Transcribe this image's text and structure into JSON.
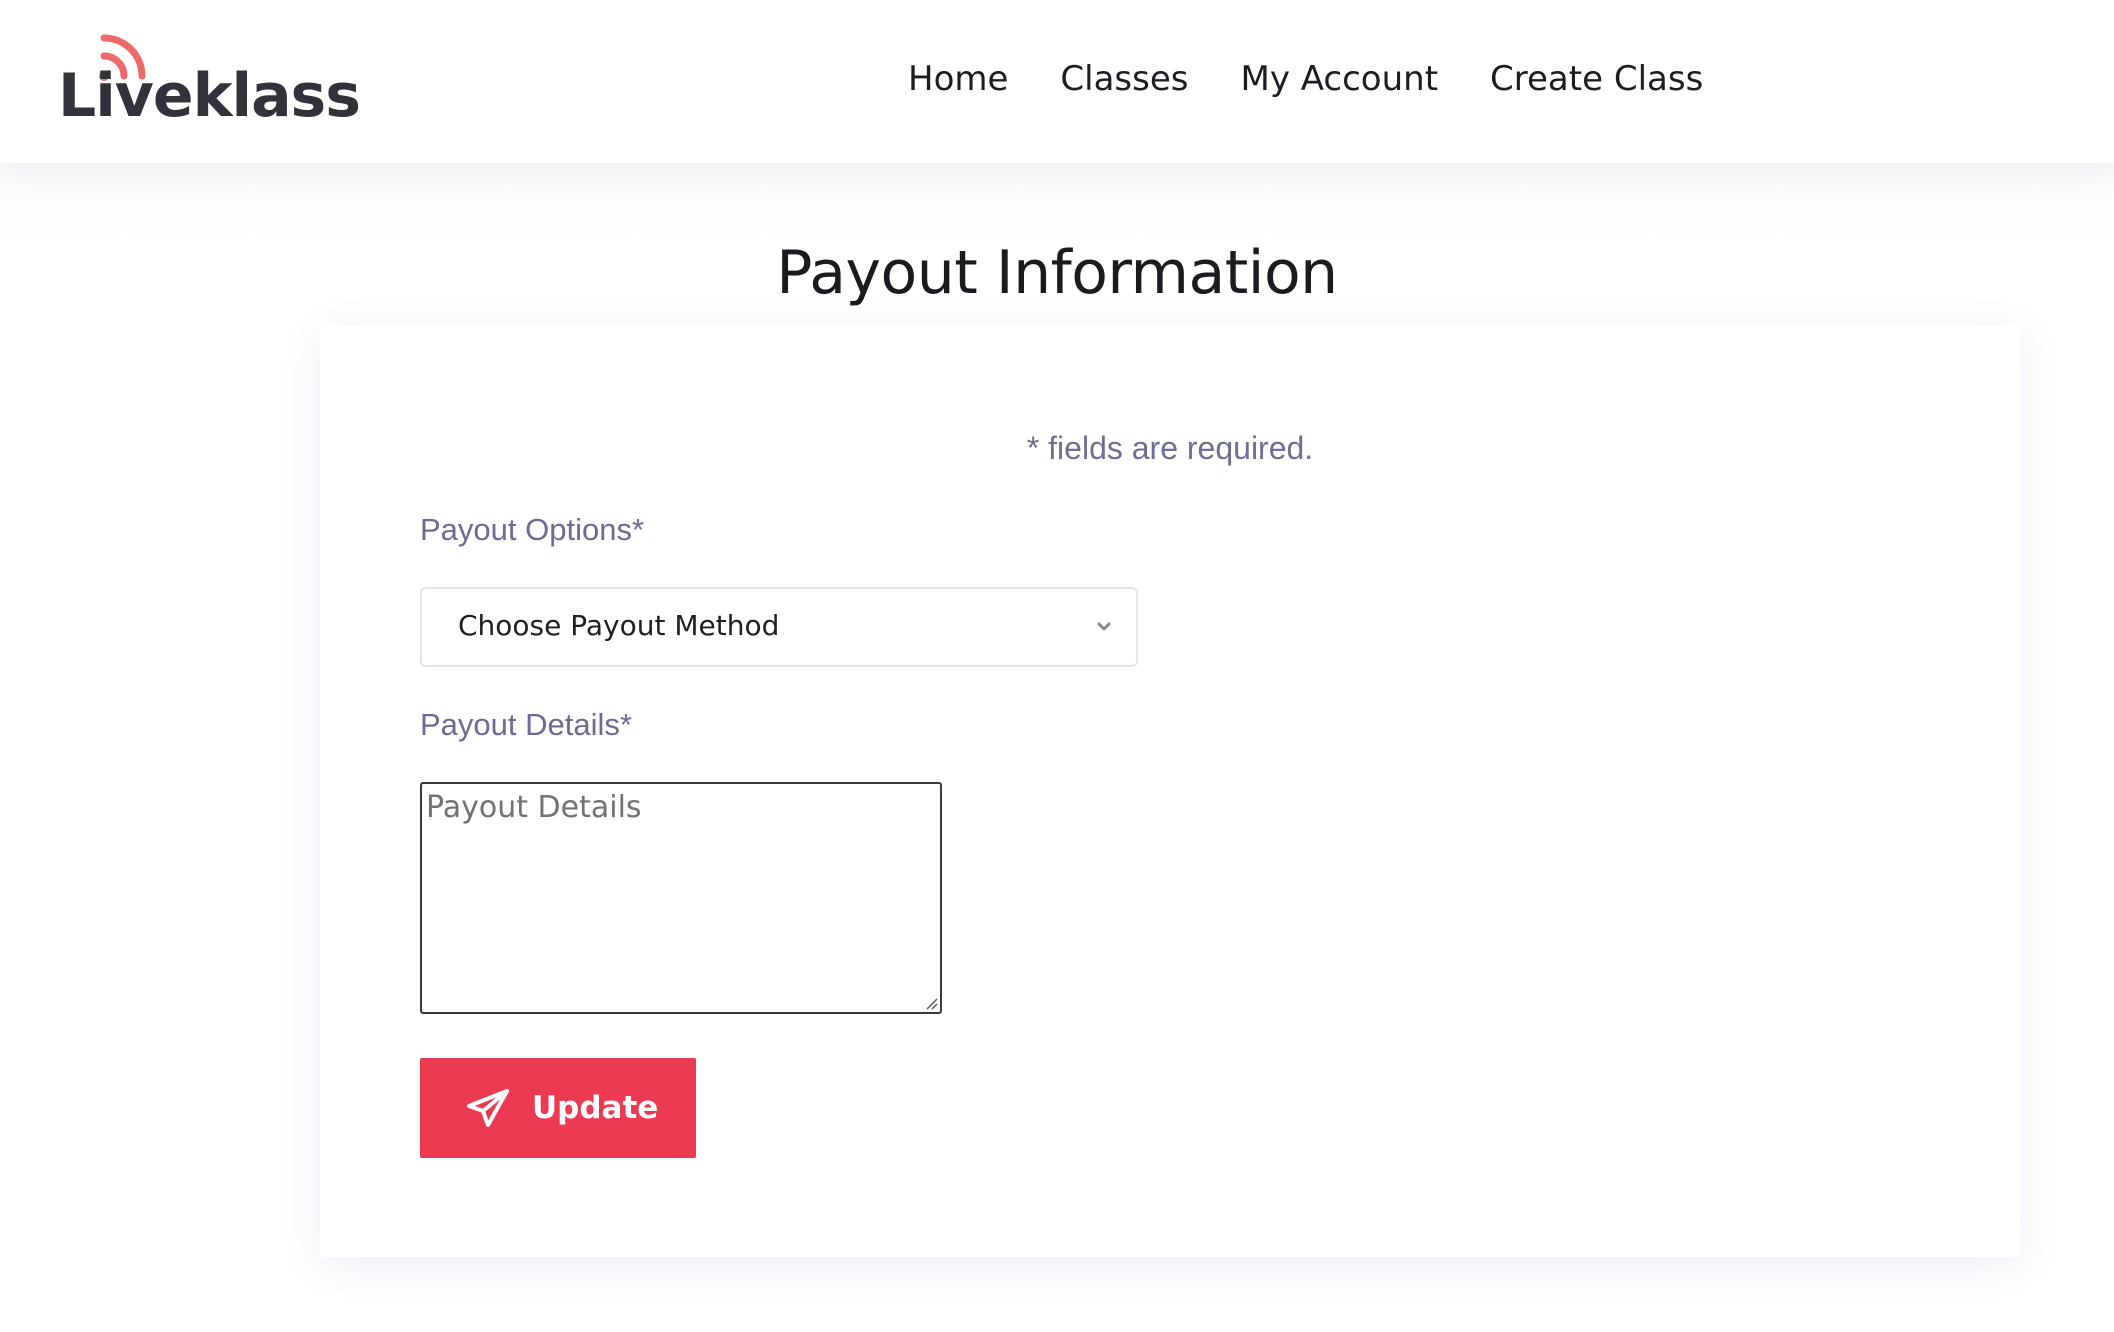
{
  "header": {
    "logo_text": "Liveklass",
    "nav": [
      {
        "label": "Home"
      },
      {
        "label": "Classes"
      },
      {
        "label": "My Account"
      },
      {
        "label": "Create Class"
      }
    ]
  },
  "page": {
    "title": "Payout Information"
  },
  "form": {
    "required_note": "* fields are required.",
    "payout_options_label": "Payout Options*",
    "payout_select_value": "Choose Payout Method",
    "payout_details_label": "Payout Details*",
    "payout_details_placeholder": "Payout Details",
    "submit_label": "Update"
  },
  "colors": {
    "accent": "#ec3a52",
    "logo_waves": "#ec6a6a",
    "label": "#6e6a96"
  },
  "icons": {
    "logo_mark": "broadcast-waves-icon",
    "select_caret": "chevron-down-icon",
    "submit_icon": "paper-plane-icon"
  }
}
